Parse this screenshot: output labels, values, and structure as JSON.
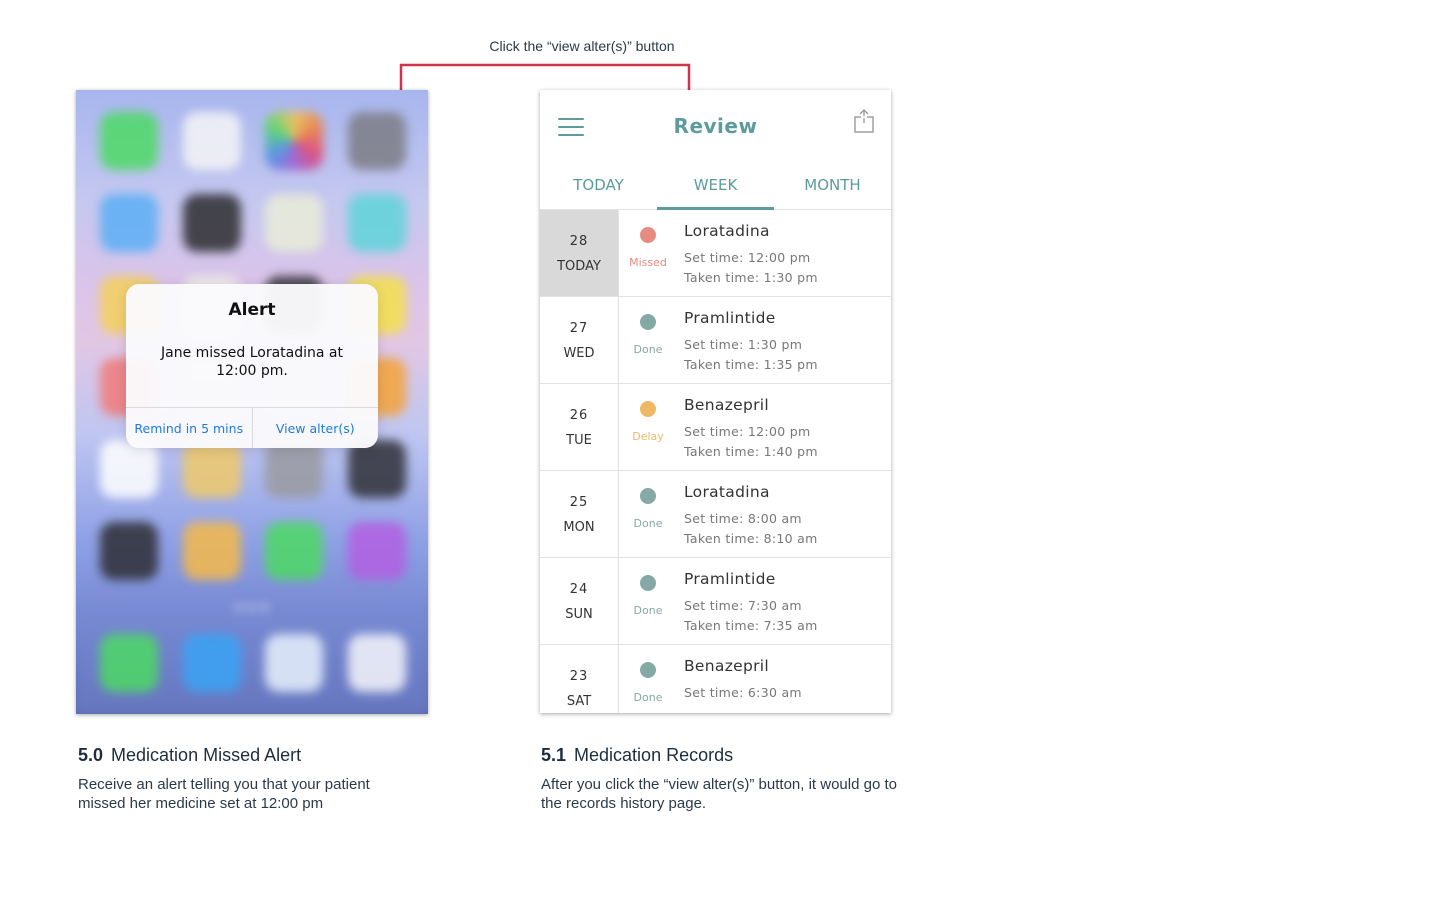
{
  "annotation": {
    "text": "Click the “view alter(s)” button"
  },
  "colors": {
    "teal": "#5e9b9c",
    "missed": "#e58b80",
    "delay": "#efb963",
    "done": "#85a9a6",
    "arrow": "#d0344a",
    "ios_blue": "#1f7ae0"
  },
  "alert": {
    "title": "Alert",
    "message": "Jane missed Loratadina at 12:00 pm.",
    "buttons": [
      "Remind in 5 mins",
      "View alter(s)"
    ]
  },
  "review": {
    "title": "Review",
    "menu_icon": "hamburger-menu-icon",
    "share_icon": "share-icon",
    "tabs": [
      "TODAY",
      "WEEK",
      "MONTH"
    ],
    "active_tab": "WEEK",
    "records": [
      {
        "date": "28",
        "day": "TODAY",
        "status": "Missed",
        "medication": "Loratadina",
        "set_time": "Set time: 12:00 pm",
        "taken_time": "Taken time: 1:30 pm",
        "is_today": true
      },
      {
        "date": "27",
        "day": "WED",
        "status": "Done",
        "medication": "Pramlintide",
        "set_time": "Set time: 1:30 pm",
        "taken_time": "Taken time: 1:35 pm"
      },
      {
        "date": "26",
        "day": "TUE",
        "status": "Delay",
        "medication": "Benazepril",
        "set_time": "Set time: 12:00 pm",
        "taken_time": "Taken time: 1:40 pm"
      },
      {
        "date": "25",
        "day": "MON",
        "status": "Done",
        "medication": "Loratadina",
        "set_time": "Set time: 8:00 am",
        "taken_time": "Taken time: 8:10 am"
      },
      {
        "date": "24",
        "day": "SUN",
        "status": "Done",
        "medication": "Pramlintide",
        "set_time": "Set time: 7:30 am",
        "taken_time": "Taken time: 7:35 am"
      },
      {
        "date": "23",
        "day": "SAT",
        "status": "Done",
        "medication": "Benazepril",
        "set_time": "Set time: 6:30 am",
        "taken_time": ""
      }
    ]
  },
  "captions": {
    "left": {
      "number": "5.0",
      "title": "Medication Missed Alert",
      "description": "Receive an alert telling you that your patient missed her medicine set at 12:00 pm"
    },
    "right": {
      "number": "5.1",
      "title": "Medication Records",
      "description": "After you click the “view alter(s)” button, it would go to the records history page."
    }
  }
}
